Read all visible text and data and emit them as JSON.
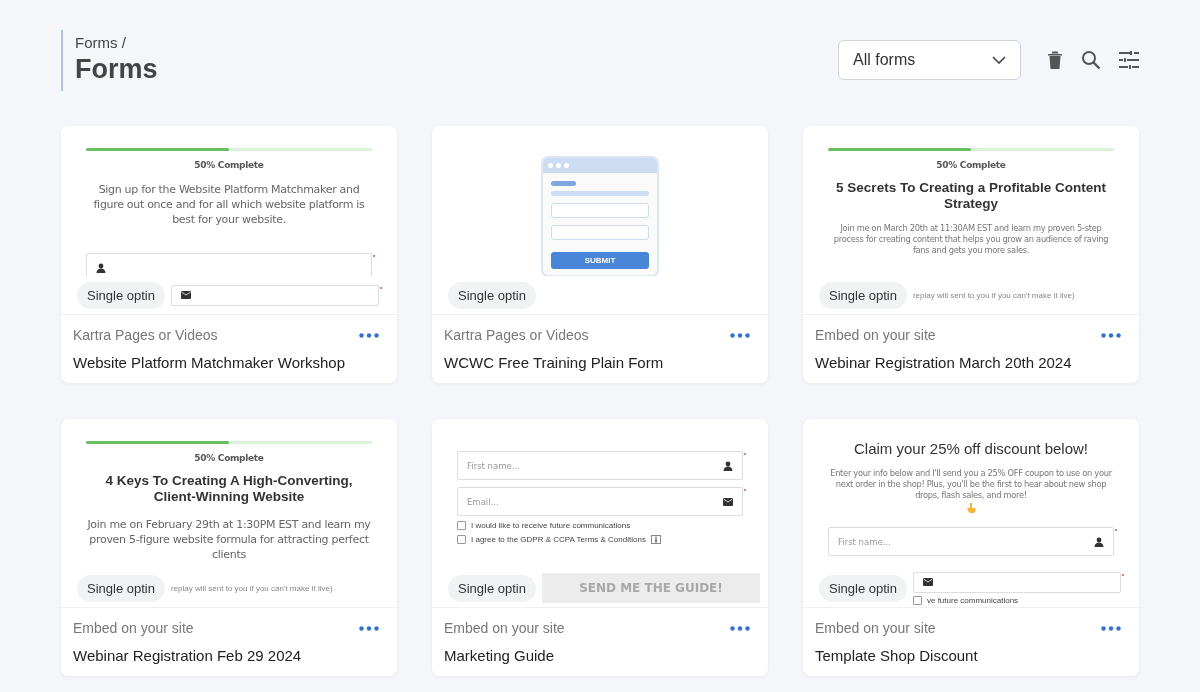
{
  "breadcrumb": "Forms /",
  "title": "Forms",
  "filter": {
    "value": "All forms"
  },
  "cards": [
    {
      "badge": "Single optin",
      "source": "Kartra Pages or Videos",
      "name": "Website Platform Matchmaker Workshop",
      "preview": {
        "kind": "progress",
        "progress": {
          "level": 0.5,
          "label": "50% Complete"
        },
        "text": "Sign up for the Website Platform Matchmaker and figure out once and for all which website platform is best for your website.",
        "fields": [
          {
            "kind": "name",
            "required": true
          },
          {
            "kind": "email",
            "required": true
          }
        ]
      }
    },
    {
      "badge": "Single optin",
      "source": "Kartra Pages or Videos",
      "name": "WCWC Free Training Plain Form",
      "preview": {
        "kind": "illustration",
        "button": "SUBMIT"
      }
    },
    {
      "badge": "Single optin",
      "source": "Embed on your site",
      "name": "Webinar Registration March 20th 2024",
      "preview": {
        "kind": "progress",
        "progress": {
          "level": 0.5,
          "label": "50% Complete"
        },
        "heading": "5 Secrets To Creating a Profitable Content Strategy",
        "text": "Join me on March 20th at 11:30AM EST and learn my proven 5-step process for creating content that helps you grow an audience of raving fans and gets you more sales.",
        "note": "replay will sent to you if you can't make it live)"
      }
    },
    {
      "badge": "Single optin",
      "source": "Embed on your site",
      "name": "Webinar Registration Feb 29 2024",
      "preview": {
        "kind": "progress",
        "progress": {
          "level": 0.5,
          "label": "50% Complete"
        },
        "heading": "4 Keys To Creating A High-Converting, Client-Winning Website",
        "text": "Join me on February 29th at 1:30PM EST and learn my proven 5-figure website formula for attracting perfect clients",
        "note": "replay will sent to you if you can't make it live)"
      }
    },
    {
      "badge": "Single optin",
      "source": "Embed on your site",
      "name": "Marketing Guide",
      "preview": {
        "kind": "fields",
        "fields": [
          {
            "kind": "name",
            "placeholder": "First name...",
            "required": true
          },
          {
            "kind": "email",
            "placeholder": "Email...",
            "required": true
          }
        ],
        "checks": [
          {
            "label": "I would like to receive future communications",
            "checked": false,
            "info": false
          },
          {
            "label": "I agree to the GDPR & CCPA Terms & Conditions",
            "checked": false,
            "info": true
          }
        ],
        "button": "SEND ME THE GUIDE!"
      }
    },
    {
      "badge": "Single optin",
      "source": "Embed on your site",
      "name": "Template Shop Discount",
      "preview": {
        "kind": "discount",
        "heading": "Claim your 25% off discount below!",
        "text": "Enter your info below and I'll send you a 25% OFF coupon to use on your next order in the shop! Plus, you'll be the first to hear about new shop drops, flash sales, and more!",
        "fields": [
          {
            "kind": "name",
            "placeholder": "First name...",
            "required": true
          },
          {
            "kind": "email",
            "required": true
          }
        ],
        "checks": [
          {
            "label": "ve future communications",
            "checked": false,
            "info": false
          }
        ]
      }
    }
  ]
}
